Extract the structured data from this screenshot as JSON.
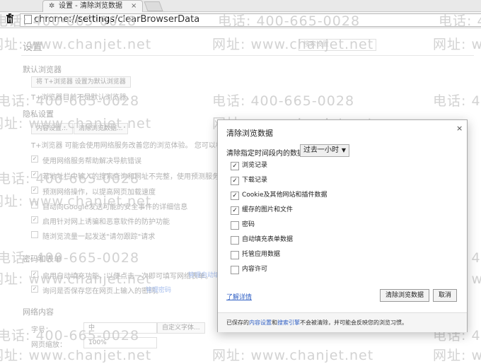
{
  "tab": {
    "title": "设置 - 清除浏览数据",
    "close": "×"
  },
  "toolbar": {
    "url_scheme": "chrome://",
    "url_host": "settings",
    "url_path": "/clearBrowserData"
  },
  "watermark": {
    "phone": "电话: 400-665-0028",
    "site": "网址: www.chanjet.net"
  },
  "settings": {
    "title": "设置",
    "search_placeholder": "搜索设置",
    "default_browser_head": "默认浏览器",
    "default_browser_button": "将 T+浏览器 设置为默认浏览器",
    "default_browser_note": "T+浏览器目前不是默认浏览器。",
    "privacy_head": "隐私设置",
    "content_settings_button": "内容设置...",
    "clear_data_button": "清除浏览数据...",
    "privacy_note": "T+浏览器 可能会使用网络服务改善您的浏览体验。 您可以根据选择停用",
    "privacy_items": [
      "使用网络服务帮助解决导航错误",
      "若地址栏中输入的搜索查询和网址不完整，使用预测服务，帮助您完成",
      "预测网络操作，以提高网页加载速度",
      "自动向Google发送可能的安全事件的详细信息",
      "启用针对网上诱骗和恶意软件的防护功能",
      "随浏览流量一起发送\"请勿跟踪\"请求"
    ],
    "passwords_head": "密码和表单",
    "autofill_item": "启用自动填充功能，以便点击一次即可填写网络表单。",
    "autofill_link": "管理自动填充",
    "password_item": "询问是否保存您在网页上输入的密码。",
    "password_link": "管理密码",
    "web_content_head": "网络内容",
    "font_size_label": "字号：",
    "font_size_value": "中",
    "custom_font_button": "自定义字体...",
    "zoom_label": "网页缩放：",
    "zoom_value": "100%"
  },
  "dialog": {
    "title": "清除浏览数据",
    "close": "×",
    "range_label": "清除指定时间段内的数据：",
    "range_value": "过去一小时",
    "options": [
      {
        "label": "浏览记录",
        "checked": true
      },
      {
        "label": "下载记录",
        "checked": true
      },
      {
        "label": "Cookie及其他网站和插件数据",
        "checked": true
      },
      {
        "label": "缓存的图片和文件",
        "checked": true
      },
      {
        "label": "密码",
        "checked": false
      },
      {
        "label": "自动填充表单数据",
        "checked": false
      },
      {
        "label": "托管应用数据",
        "checked": false
      },
      {
        "label": "内容许可",
        "checked": false
      }
    ],
    "learn_more": "了解详情",
    "clear_button": "清除浏览数据",
    "cancel_button": "取消",
    "footer_prefix": "已保存的",
    "footer_link1": "内容设置",
    "footer_and": "和",
    "footer_link2": "搜索引擎",
    "footer_suffix": "不会被清除，并可能会反映您的浏览习惯。"
  }
}
